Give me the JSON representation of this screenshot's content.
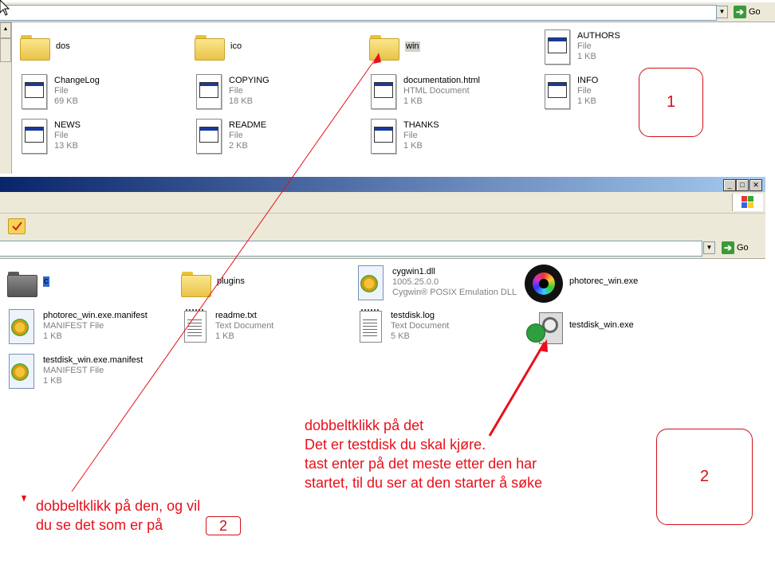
{
  "window_top": {
    "go_label": "Go",
    "files": [
      {
        "name": "dos",
        "kind": "folder"
      },
      {
        "name": "ico",
        "kind": "folder"
      },
      {
        "name": "win",
        "kind": "folder"
      },
      {
        "name": "AUTHORS",
        "type": "File",
        "size": "1 KB"
      },
      {
        "name": "ChangeLog",
        "type": "File",
        "size": "69 KB"
      },
      {
        "name": "COPYING",
        "type": "File",
        "size": "18 KB"
      },
      {
        "name": "documentation.html",
        "type": "HTML Document",
        "size": "1 KB"
      },
      {
        "name": "INFO",
        "type": "File",
        "size": "1 KB"
      },
      {
        "name": "NEWS",
        "type": "File",
        "size": "13 KB"
      },
      {
        "name": "README",
        "type": "File",
        "size": "2 KB"
      },
      {
        "name": "THANKS",
        "type": "File",
        "size": "1 KB"
      }
    ]
  },
  "window_bottom": {
    "go_label": "Go",
    "files": [
      {
        "name": "c",
        "kind": "folder-dark"
      },
      {
        "name": "plugins",
        "kind": "folder"
      },
      {
        "name": "cygwin1.dll",
        "type": "1005.25.0.0",
        "size": "Cygwin® POSIX Emulation DLL"
      },
      {
        "name": "photorec_win.exe"
      },
      {
        "name": "photorec_win.exe.manifest",
        "type": "MANIFEST File",
        "size": "1 KB"
      },
      {
        "name": "readme.txt",
        "type": "Text Document",
        "size": "1 KB"
      },
      {
        "name": "testdisk.log",
        "type": "Text Document",
        "size": "5 KB"
      },
      {
        "name": "testdisk_win.exe"
      },
      {
        "name": "testdisk_win.exe.manifest",
        "type": "MANIFEST File",
        "size": "1 KB"
      }
    ]
  },
  "annotations": {
    "box1": "1",
    "box2": "2",
    "note_left_line1": "dobbeltklikk på den, og vil",
    "note_left_line2": "du se det som er på",
    "note_left_box": "2",
    "note_right_lines": [
      "dobbeltklikk på det",
      "Det er testdisk du skal kjøre.",
      "tast enter på det meste etter den har",
      "startet, til du ser at den starter å søke"
    ],
    "color": "#e8101a"
  }
}
